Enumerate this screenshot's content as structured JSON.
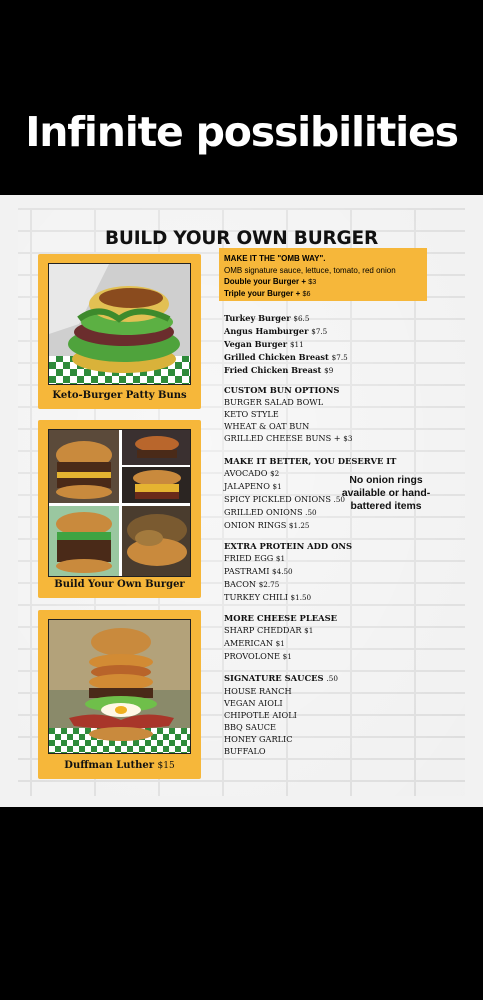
{
  "headline": "Infinite possibilities",
  "menu": {
    "title": "BUILD YOUR OWN BURGER",
    "cards": [
      {
        "caption": "Keto-Burger Patty Buns",
        "price": ""
      },
      {
        "caption": "Build Your Own Burger",
        "price": ""
      },
      {
        "caption": "Duffman Luther",
        "price": "$15"
      }
    ],
    "omb": {
      "heading": "MAKE IT THE \"OMB WAY\".",
      "desc": "OMB signature sauce, lettuce, tomato, red onion",
      "double": "Double your Burger +",
      "double_price": "$3",
      "triple": "Triple your Burger +",
      "triple_price": "$6"
    },
    "burgers": [
      {
        "name": "Turkey Burger",
        "price": "$6.5"
      },
      {
        "name": "Angus Hamburger",
        "price": "$7.5"
      },
      {
        "name": "Vegan Burger",
        "price": "$11"
      },
      {
        "name": "Grilled Chicken Breast",
        "price": "$7.5"
      },
      {
        "name": "Fried Chicken Breast",
        "price": "$9"
      }
    ],
    "bun": {
      "heading": "CUSTOM BUN OPTIONS",
      "items": [
        "BURGER SALAD BOWL",
        "KETO STYLE",
        "WHEAT & OAT BUN",
        "GRILLED CHEESE BUNS +"
      ],
      "last_price": "$3"
    },
    "better": {
      "heading": "MAKE IT BETTER, YOU DESERVE IT",
      "items": [
        {
          "name": "AVOCADO",
          "price": "$2"
        },
        {
          "name": "JALAPENO",
          "price": "$1"
        },
        {
          "name": "SPICY PICKLED ONIONS",
          "price": ".50"
        },
        {
          "name": "GRILLED ONIONS",
          "price": ".50"
        },
        {
          "name": "ONION RINGS",
          "price": "$1.25"
        }
      ],
      "note": "No onion rings available or hand-battered items"
    },
    "protein": {
      "heading": "EXTRA PROTEIN ADD ONS",
      "items": [
        {
          "name": "FRIED EGG",
          "price": "$1"
        },
        {
          "name": "PASTRAMI",
          "price": "$4.50"
        },
        {
          "name": "BACON",
          "price": "$2.75"
        },
        {
          "name": "TURKEY CHILI",
          "price": "$1.50"
        }
      ]
    },
    "cheese": {
      "heading": "MORE CHEESE PLEASE",
      "items": [
        {
          "name": "SHARP CHEDDAR",
          "price": "$1"
        },
        {
          "name": "AMERICAN",
          "price": "$1"
        },
        {
          "name": "PROVOLONE",
          "price": "$1"
        }
      ]
    },
    "sauces": {
      "heading": "SIGNATURE SAUCES",
      "price": ".50",
      "items": [
        "HOUSE RANCH",
        "VEGAN AIOLI",
        "CHIPOTLE AIOLI",
        "BBQ SAUCE",
        "HONEY GARLIC",
        "BUFFALO"
      ]
    }
  }
}
